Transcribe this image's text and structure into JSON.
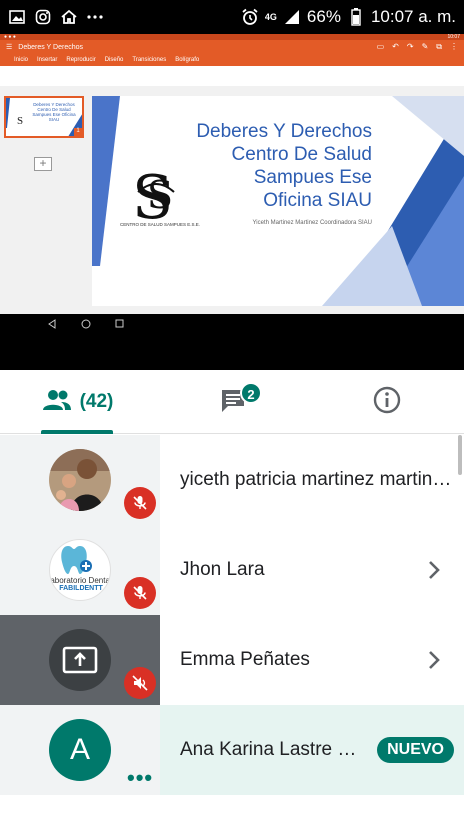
{
  "status_bar": {
    "network": "4G",
    "battery": "66%",
    "time": "10:07 a. m."
  },
  "shared_screen": {
    "mini_time": "10:07",
    "app_title": "Deberes Y Derechos",
    "menu": [
      "Inicio",
      "Insertar",
      "Reproducir",
      "Diseño",
      "Transiciones",
      "Bolígrafo"
    ],
    "thumbnail_text": "Deberes Y Derechos Centro De Salud Sampues Ese Oficina SIAU",
    "thumbnail_number": "1",
    "slide": {
      "title_lines": [
        "Deberes Y Derechos",
        "Centro De Salud",
        "Sampues Ese",
        "Oficina SIAU"
      ],
      "subtitle": "Yiceth  Martinez Martinez Coordinadora SIAU",
      "logo_caption": "CENTRO DE SALUD SAMPUES E.S.E."
    }
  },
  "tabs": {
    "people_count": "(42)",
    "chat_badge": "2"
  },
  "participants": [
    {
      "name": "yiceth patricia martinez martinez",
      "tile": "photo",
      "muted": true,
      "chevron": false
    },
    {
      "name": "Jhon Lara",
      "tile": "logo",
      "logo_text_1": "aboratorio Dental",
      "logo_text_2": "FABILDENTT",
      "muted": true,
      "chevron": true
    },
    {
      "name": "Emma Peñates",
      "tile": "presenting",
      "muted": true,
      "chevron": true
    },
    {
      "name": "Ana Karina Lastre Montes",
      "tile": "initial",
      "initial": "A",
      "badge": "NUEVO",
      "more": "•••"
    }
  ],
  "colors": {
    "accent": "#00796b",
    "mute_red": "#d93025",
    "ppt_orange": "#e35b27",
    "slide_blue": "#2d5db1"
  }
}
